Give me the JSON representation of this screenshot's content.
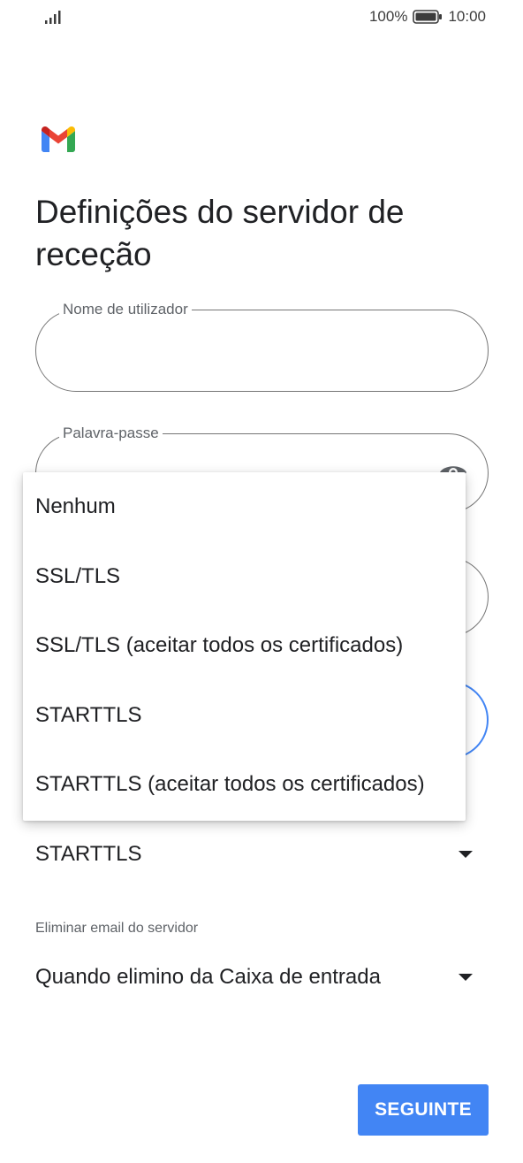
{
  "status_bar": {
    "battery_percent": "100%",
    "time": "10:00",
    "icons": [
      "signal-icon",
      "battery-icon"
    ]
  },
  "page": {
    "title": "Definições do servidor de receção"
  },
  "form": {
    "username": {
      "label": "Nome de utilizador",
      "value": ""
    },
    "password": {
      "label": "Palavra-passe",
      "value": ""
    },
    "security": {
      "value": "STARTTLS"
    },
    "delete_email": {
      "label": "Eliminar email do servidor",
      "value": "Quando elimino da Caixa de entrada"
    }
  },
  "menu": {
    "items": [
      "Nenhum",
      "SSL/TLS",
      "SSL/TLS (aceitar todos os certificados)",
      "STARTTLS",
      "STARTTLS (aceitar todos os certificados)"
    ]
  },
  "actions": {
    "next_label": "SEGUINTE"
  },
  "colors": {
    "accent": "#4285f4",
    "text": "#202124",
    "secondary_text": "#5f6368"
  }
}
